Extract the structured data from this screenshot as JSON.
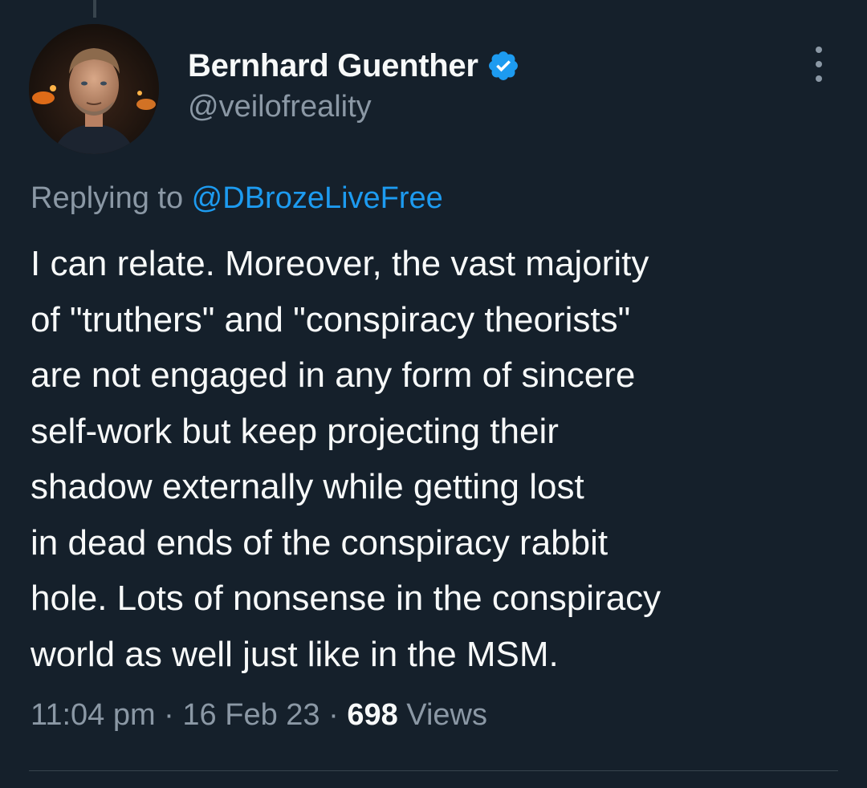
{
  "author": {
    "display_name": "Bernhard Guenther",
    "handle": "@veilofreality",
    "verified": true
  },
  "icons": {
    "verified": "verified-badge-icon",
    "more": "more-options-icon",
    "avatar": "profile-photo"
  },
  "reply": {
    "prefix": "Replying to ",
    "to_handle": "@DBrozeLiveFree"
  },
  "tweet": {
    "lines": [
      "I can relate. Moreover, the vast majority",
      "of \"truthers\" and \"conspiracy theorists\"",
      "are not engaged in any form of sincere",
      "self-work but keep projecting their",
      "shadow externally while getting lost",
      "in dead ends of the conspiracy rabbit",
      "hole. Lots of nonsense in the conspiracy",
      "world as well just like in the MSM."
    ]
  },
  "meta": {
    "time": "11:04 pm",
    "separator": " · ",
    "date": "16 Feb 23",
    "views_count": "698",
    "views_label": " Views"
  },
  "colors": {
    "background": "#15202b",
    "text_primary": "#f7f9f9",
    "text_secondary": "#8b98a5",
    "link": "#1d9bf0",
    "divider": "#38444d",
    "verified_badge": "#1d9bf0"
  }
}
